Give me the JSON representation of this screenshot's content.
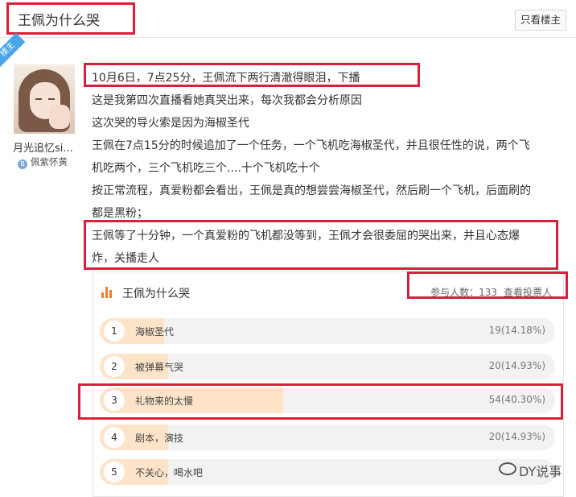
{
  "header": {
    "title": "王佩为什么哭",
    "only_op_label": "只看楼主"
  },
  "user": {
    "op_tag": "楼主",
    "name": "月光追忆si...",
    "badge_icon": "B",
    "badge_text": "佩紫怀黄"
  },
  "post": {
    "lines": [
      "10月6日，7点25分，王佩流下两行清澈得眼泪，下播",
      "这是我第四次直播看她真哭出来，每次我都会分析原因",
      "这次哭的导火索是因为海椒圣代",
      "王佩在7点15分的时候追加了一个任务，一个飞机吃海椒圣代，并且很任性的说，两个飞",
      "机吃两个，三个飞机吃三个....十个飞机吃十个",
      "按正常流程，真爱粉都会看出，王佩是真的想尝尝海椒圣代，然后刷一个飞机，后面刷的",
      "都是黑粉；",
      "王佩等了十分钟，一个真爱粉的飞机都没等到，王佩才会很委屈的哭出来，并且心态爆",
      "炸，关播走人"
    ]
  },
  "poll": {
    "title": "王佩为什么哭",
    "participants_label": "参与人数：133",
    "view_voters_label": "查看投票人",
    "options": [
      {
        "num": "1",
        "label": "海椒圣代",
        "count": "19(14.18%)",
        "fraction": 0.1418
      },
      {
        "num": "2",
        "label": "被弹幕气哭",
        "count": "20(14.93%)",
        "fraction": 0.1493
      },
      {
        "num": "3",
        "label": "礼物来的太慢",
        "count": "54(40.30%)",
        "fraction": 0.403
      },
      {
        "num": "4",
        "label": "剧本，演技",
        "count": "20(14.93%)",
        "fraction": 0.1493
      },
      {
        "num": "5",
        "label": "不关心，喝水吧",
        "count": "",
        "fraction": 0.1493
      }
    ]
  },
  "watermark": {
    "text": "DY说事"
  },
  "colors": {
    "highlight_box": "#d9203a",
    "poll_fill": "#fde4c9",
    "poll_track": "#f2f2f2",
    "poll_icon": "#f17a2d",
    "op_ribbon": "#4aa4e8"
  }
}
